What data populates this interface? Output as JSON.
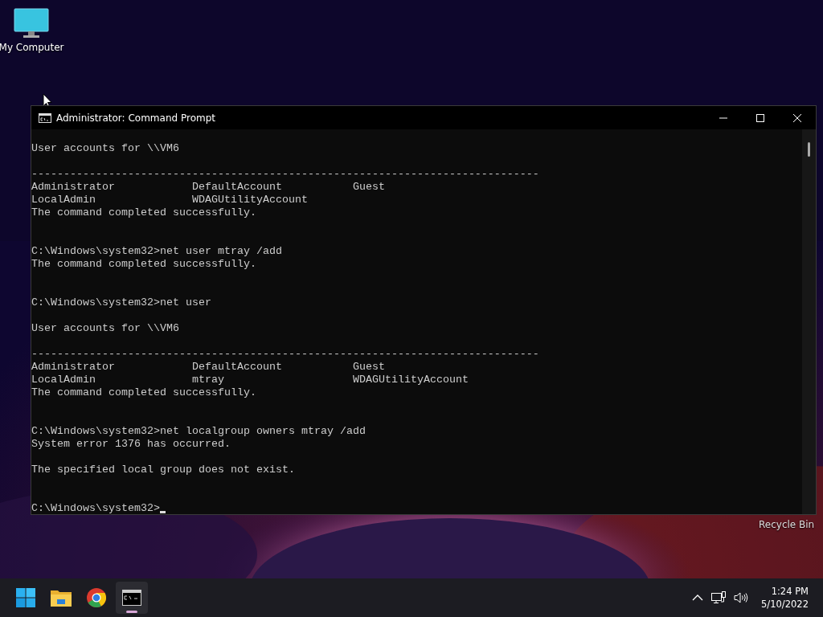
{
  "desktop": {
    "icons": [
      {
        "kind": "computer",
        "label": "My Computer"
      }
    ],
    "recycle_bin": {
      "label": "Recycle Bin"
    }
  },
  "window": {
    "title": "Administrator: Command Prompt",
    "console": {
      "lines": [
        {
          "kind": "text",
          "text": "User accounts for \\\\VM6"
        },
        {
          "kind": "blank"
        },
        {
          "kind": "text",
          "text": "-------------------------------------------------------------------------------"
        },
        {
          "kind": "text",
          "text": "Administrator            DefaultAccount           Guest"
        },
        {
          "kind": "text",
          "text": "LocalAdmin               WDAGUtilityAccount"
        },
        {
          "kind": "text",
          "text": "The command completed successfully."
        },
        {
          "kind": "blank"
        },
        {
          "kind": "blank"
        },
        {
          "kind": "text",
          "text": "C:\\Windows\\system32>net user mtray /add"
        },
        {
          "kind": "text",
          "text": "The command completed successfully."
        },
        {
          "kind": "blank"
        },
        {
          "kind": "blank"
        },
        {
          "kind": "text",
          "text": "C:\\Windows\\system32>net user"
        },
        {
          "kind": "blank"
        },
        {
          "kind": "text",
          "text": "User accounts for \\\\VM6"
        },
        {
          "kind": "blank"
        },
        {
          "kind": "text",
          "text": "-------------------------------------------------------------------------------"
        },
        {
          "kind": "text",
          "text": "Administrator            DefaultAccount           Guest"
        },
        {
          "kind": "text",
          "text": "LocalAdmin               mtray                    WDAGUtilityAccount"
        },
        {
          "kind": "text",
          "text": "The command completed successfully."
        },
        {
          "kind": "blank"
        },
        {
          "kind": "blank"
        },
        {
          "kind": "text",
          "text": "C:\\Windows\\system32>net localgroup owners mtray /add"
        },
        {
          "kind": "text",
          "text": "System error 1376 has occurred."
        },
        {
          "kind": "blank"
        },
        {
          "kind": "text",
          "text": "The specified local group does not exist."
        },
        {
          "kind": "blank"
        },
        {
          "kind": "blank"
        }
      ],
      "prompt": "C:\\Windows\\system32>"
    }
  },
  "taskbar": {
    "apps": [
      {
        "kind": "start",
        "selected": false
      },
      {
        "kind": "folder",
        "selected": false
      },
      {
        "kind": "browser",
        "selected": false
      },
      {
        "kind": "terminal",
        "selected": true
      }
    ],
    "tray": {
      "time": "1:24 PM",
      "date": "5/10/2022"
    }
  }
}
